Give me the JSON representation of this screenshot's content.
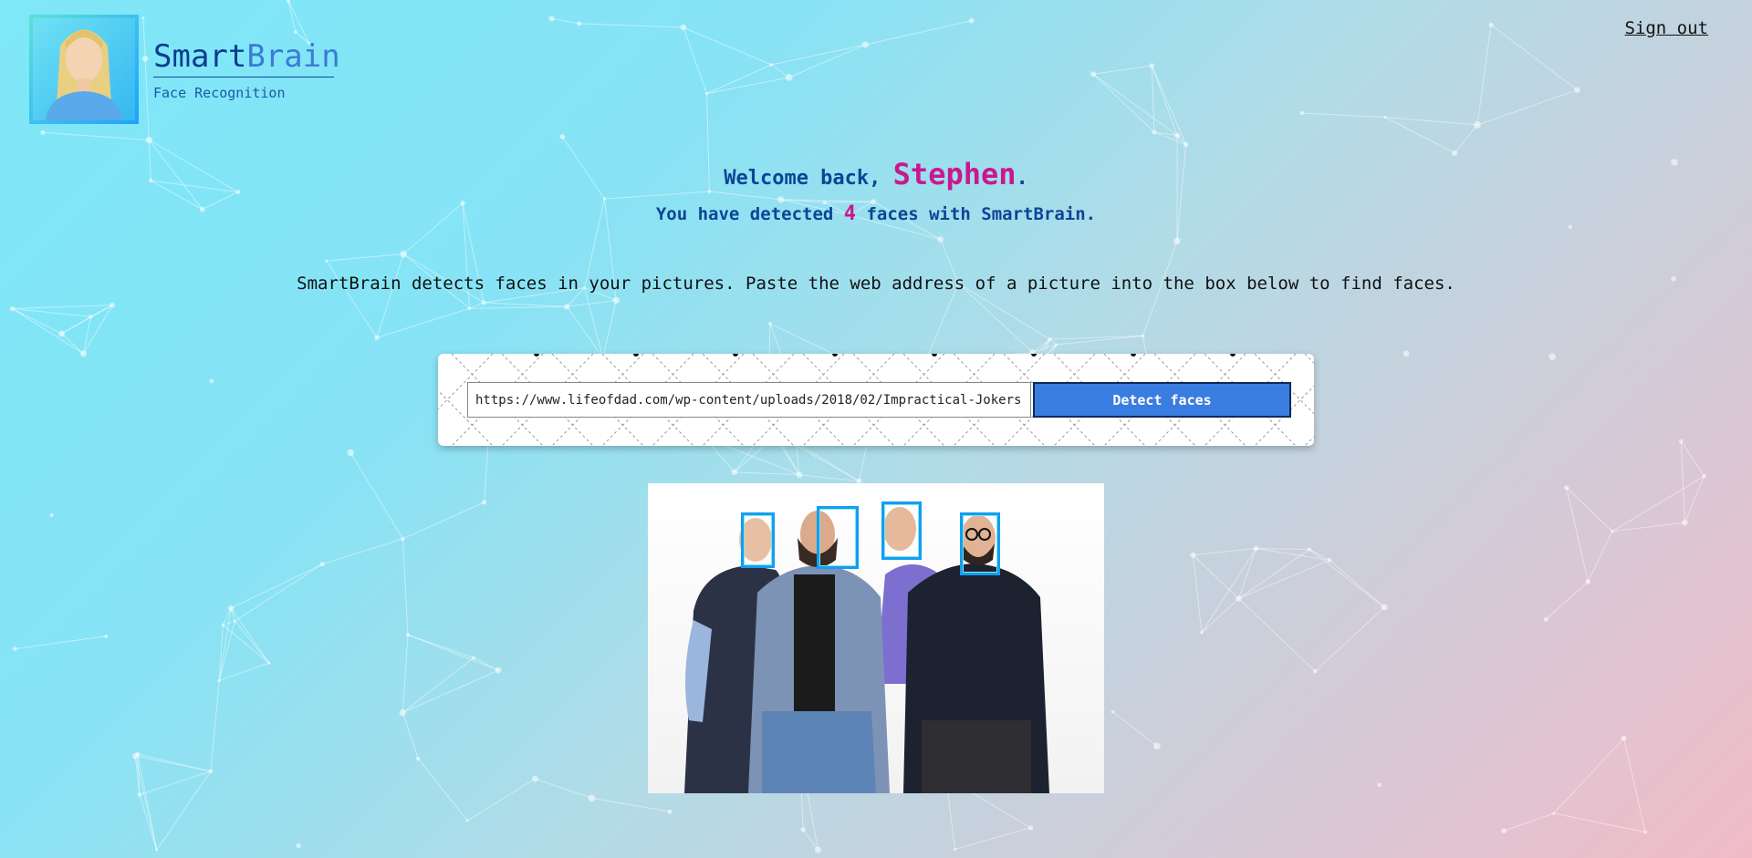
{
  "brand": {
    "title_part1": "Smart",
    "title_part2": "Brain",
    "subtitle": "Face Recognition",
    "logo_icon": "user-avatar-icon"
  },
  "nav": {
    "sign_out": "Sign out"
  },
  "welcome": {
    "prefix": "Welcome back, ",
    "user_name": "Stephen",
    "suffix": "."
  },
  "stats": {
    "prefix": "You have detected ",
    "count": "4",
    "suffix": " faces with SmartBrain."
  },
  "description": "SmartBrain detects faces in your pictures. Paste the web address of a picture into the box below to find faces.",
  "form": {
    "url_value": "https://www.lifeofdad.com/wp-content/uploads/2018/02/Impractical-Jokers",
    "button_label": "Detect faces"
  },
  "result": {
    "faces_detected": 4
  },
  "colors": {
    "accent_blue": "#3a7de0",
    "brand_dark": "#0b3d8f",
    "highlight_magenta": "#c9188f",
    "face_box": "#149df2"
  }
}
